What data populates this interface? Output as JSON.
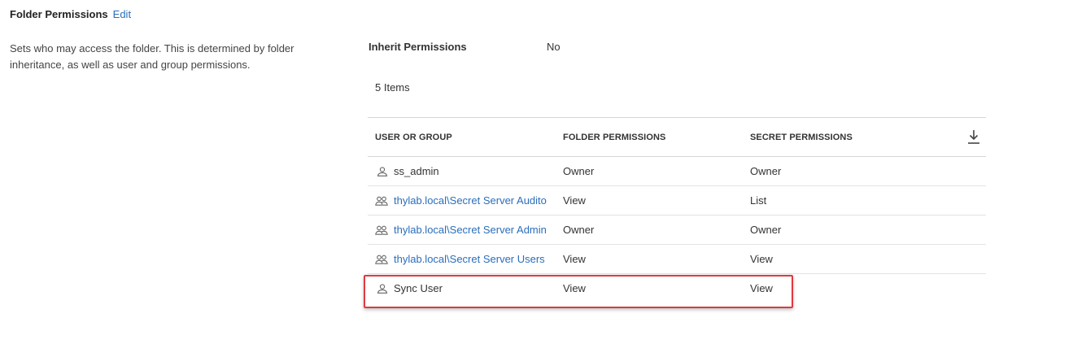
{
  "section": {
    "title": "Folder Permissions",
    "edit_label": "Edit",
    "description": "Sets who may access the folder. This is determined by folder inheritance, as well as user and group permissions."
  },
  "inherit": {
    "label": "Inherit Permissions",
    "value": "No"
  },
  "items_count": "5 Items",
  "table": {
    "columns": [
      "USER OR GROUP",
      "FOLDER PERMISSIONS",
      "SECRET PERMISSIONS"
    ],
    "download_icon": "download-icon",
    "rows": [
      {
        "type": "user",
        "name": "ss_admin",
        "folder": "Owner",
        "secret": "Owner"
      },
      {
        "type": "group",
        "name": "thylab.local\\Secret Server Audito",
        "folder": "View",
        "secret": "List"
      },
      {
        "type": "group",
        "name": "thylab.local\\Secret Server Admin",
        "folder": "Owner",
        "secret": "Owner"
      },
      {
        "type": "group",
        "name": "thylab.local\\Secret Server Users",
        "folder": "View",
        "secret": "View"
      },
      {
        "type": "user",
        "name": "Sync User",
        "folder": "View",
        "secret": "View"
      }
    ]
  },
  "colors": {
    "link": "#2a6ebb",
    "highlight": "#e0393e",
    "border": "#e3e3e3"
  }
}
